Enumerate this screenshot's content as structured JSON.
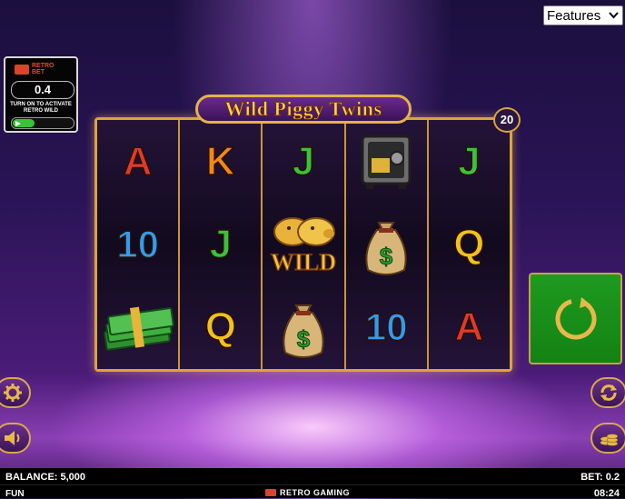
{
  "features": {
    "selected": "Features"
  },
  "retro_bet": {
    "logo_line1": "RETRO",
    "logo_line2": "BET",
    "value": "0.4",
    "caption_line1": "TURN ON TO ACTIVATE",
    "caption_line2": "RETRO WILD"
  },
  "game": {
    "title": "Wild Piggy Twins",
    "lines": "20",
    "wild_label": "WILD",
    "reels": [
      [
        "A",
        "10",
        "cash-stack"
      ],
      [
        "K",
        "J",
        "Q"
      ],
      [
        "J",
        "piggy-wild",
        "money-bag"
      ],
      [
        "safe",
        "money-bag",
        "10"
      ],
      [
        "J",
        "Q",
        "A"
      ]
    ]
  },
  "bottom_bar": {
    "balance": "BALANCE: 5,000",
    "bet": "BET: 0.2",
    "mode": "FUN",
    "brand": "RETRO GAMING",
    "time": "08:24"
  },
  "colors": {
    "reel_border": "#d9a53c",
    "spin_green": "#1a8f1a",
    "gold": "#ffd34a",
    "purple": "#3b1558"
  },
  "icons": [
    "settings-gear-icon",
    "sound-icon",
    "autoplay-icon",
    "coins-bet-icon",
    "spin-arrow-icon",
    "chevron-down-icon"
  ]
}
